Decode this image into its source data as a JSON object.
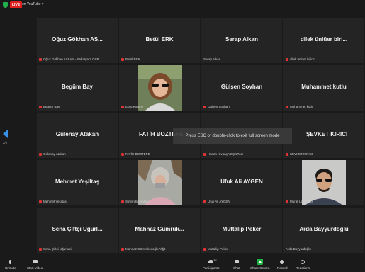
{
  "topbar": {
    "live_badge": "LIVE",
    "live_platform": "on YouTube ▾"
  },
  "tiles": [
    {
      "name": "Oğuz Gökhan AS...",
      "label": "Oğuz Gökhan ASLAN - Sakarya 2.OSB",
      "photo": false
    },
    {
      "name": "Betül ERK",
      "label": "Betül ERK",
      "photo": false
    },
    {
      "name": "Serap Alkan",
      "label": "Serap Alkan",
      "photo": false
    },
    {
      "name": "dilek ünlüer biri...",
      "label": "dilek ünlüer birinci",
      "photo": false
    },
    {
      "name": "Begüm Bay",
      "label": "Begüm Bay",
      "photo": false
    },
    {
      "name": "",
      "label": "Ebru Kırtepe",
      "photo": "ebru"
    },
    {
      "name": "Gülşen Soyhan",
      "label": "Gülşen Soyhan",
      "photo": false
    },
    {
      "name": "Muhammet kutlu",
      "label": "Muhammet kutlu",
      "photo": false
    },
    {
      "name": "Gülenay Atakan",
      "label": "Gülenay Atakan",
      "photo": false
    },
    {
      "name": "FATİH BOZTEPE",
      "label": "FATİH BOZTEPE",
      "photo": false
    },
    {
      "name": "",
      "label": "Hasan Kıvanç YEŞİLTAŞ",
      "photo": false
    },
    {
      "name": "ŞEVKET KIRICI",
      "label": "ŞEVKET KIRICI",
      "photo": false
    },
    {
      "name": "Mehmet Yeşiltaş",
      "label": "Mehmet Yeşiltaş",
      "photo": false
    },
    {
      "name": "",
      "label": "Sinem Bayraktar",
      "photo": "sinem"
    },
    {
      "name": "Ufuk Ali AYGEN",
      "label": "Ufuk Ali AYGEN",
      "photo": false
    },
    {
      "name": "",
      "label": "Murat Uncuoğlu",
      "photo": "murat"
    },
    {
      "name": "Sena Çiftçi Uğurl...",
      "label": "Sena Çiftçi Uğurlubil",
      "photo": false
    },
    {
      "name": "Mahnaz Gümrük...",
      "label": "Mahnaz Gümrükçüoğlu Yiğit",
      "photo": false
    },
    {
      "name": "Muttalip Peker",
      "label": "Muttalip Peker",
      "photo": false
    },
    {
      "name": "Arda Bayyurdoğlu",
      "label": "Arda Bayyurdoğlu",
      "photo": false
    }
  ],
  "pager": {
    "page": "2/2"
  },
  "toast": "Press ESC or double-click to exit full screen mode",
  "toolbar": {
    "unmute": "Unmute",
    "start_video": "Start Video",
    "participants": "Participants",
    "participants_count": "34",
    "chat": "Chat",
    "share_screen": "Share Screen",
    "record": "Record",
    "reactions": "Reactions"
  }
}
